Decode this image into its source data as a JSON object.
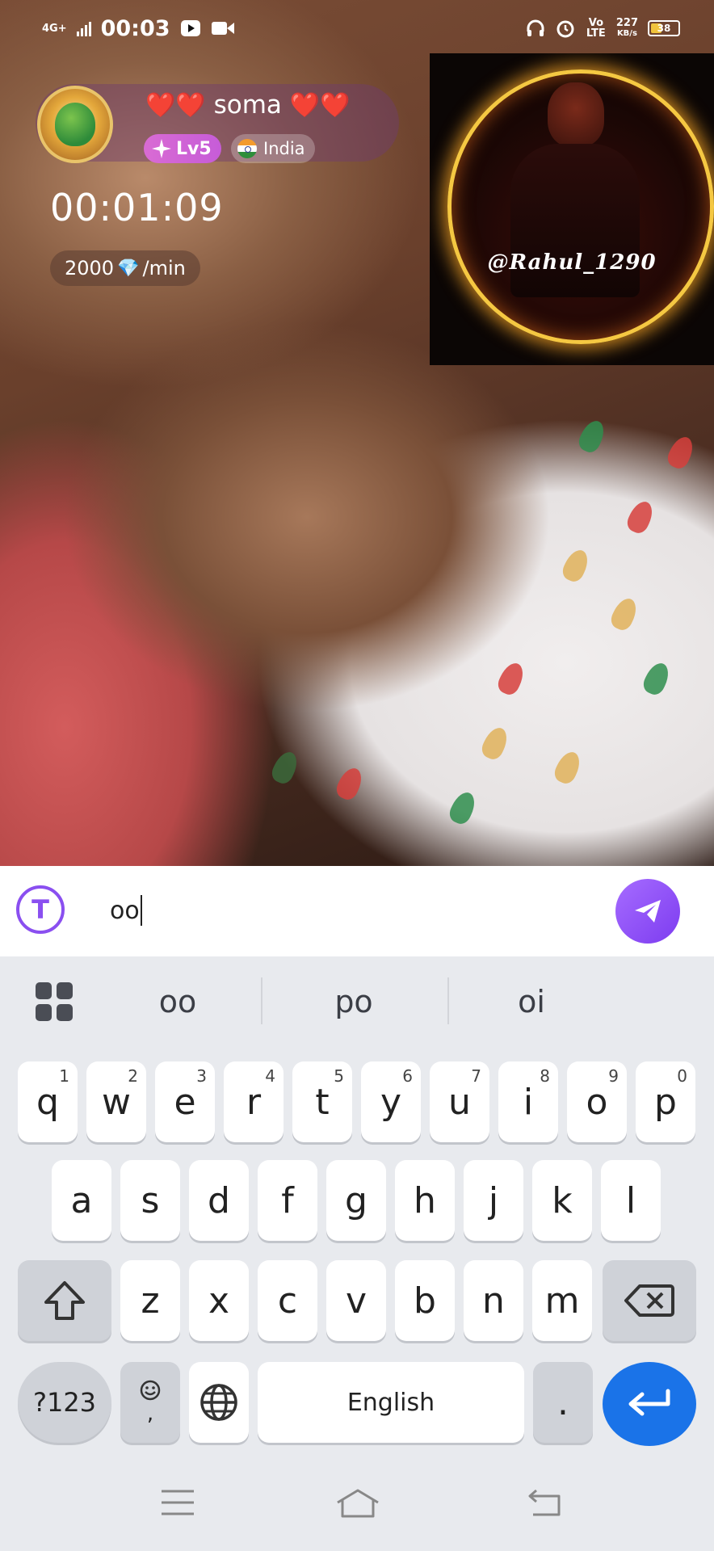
{
  "status_bar": {
    "network": "4G+",
    "time": "00:03",
    "volte": "Vo LTE",
    "speed": "227",
    "speed_unit": "KB/s",
    "battery": "38"
  },
  "host": {
    "hearts_left": "❤️❤️",
    "name": "soma",
    "hearts_right": "❤️❤️",
    "level": "Lv5",
    "country": "India",
    "timer": "00:01:09",
    "rate_amount": "2000",
    "rate_unit": "/min"
  },
  "pip": {
    "handle": "@Rahul_1290"
  },
  "composer": {
    "value": "oo",
    "icon_letter": "T"
  },
  "keyboard": {
    "suggestions": [
      "oo",
      "po",
      "oi"
    ],
    "row1": [
      {
        "k": "q",
        "h": "1"
      },
      {
        "k": "w",
        "h": "2"
      },
      {
        "k": "e",
        "h": "3"
      },
      {
        "k": "r",
        "h": "4"
      },
      {
        "k": "t",
        "h": "5"
      },
      {
        "k": "y",
        "h": "6"
      },
      {
        "k": "u",
        "h": "7"
      },
      {
        "k": "i",
        "h": "8"
      },
      {
        "k": "o",
        "h": "9"
      },
      {
        "k": "p",
        "h": "0"
      }
    ],
    "row2": [
      "a",
      "s",
      "d",
      "f",
      "g",
      "h",
      "j",
      "k",
      "l"
    ],
    "row3": [
      "z",
      "x",
      "c",
      "v",
      "b",
      "n",
      "m"
    ],
    "symbols_label": "?123",
    "emoji_comma": ",",
    "space_label": "English",
    "period_label": "."
  },
  "icons": {
    "send": "send-icon",
    "shift": "shift-icon",
    "backspace": "backspace-icon",
    "globe": "globe-icon",
    "enter": "enter-icon",
    "menu": "menu-icon",
    "home": "home-icon",
    "back": "back-icon"
  },
  "colors": {
    "accent_purple": "#8a4ff0",
    "enter_blue": "#1a73e8",
    "level_badge": "#d96bd3"
  }
}
